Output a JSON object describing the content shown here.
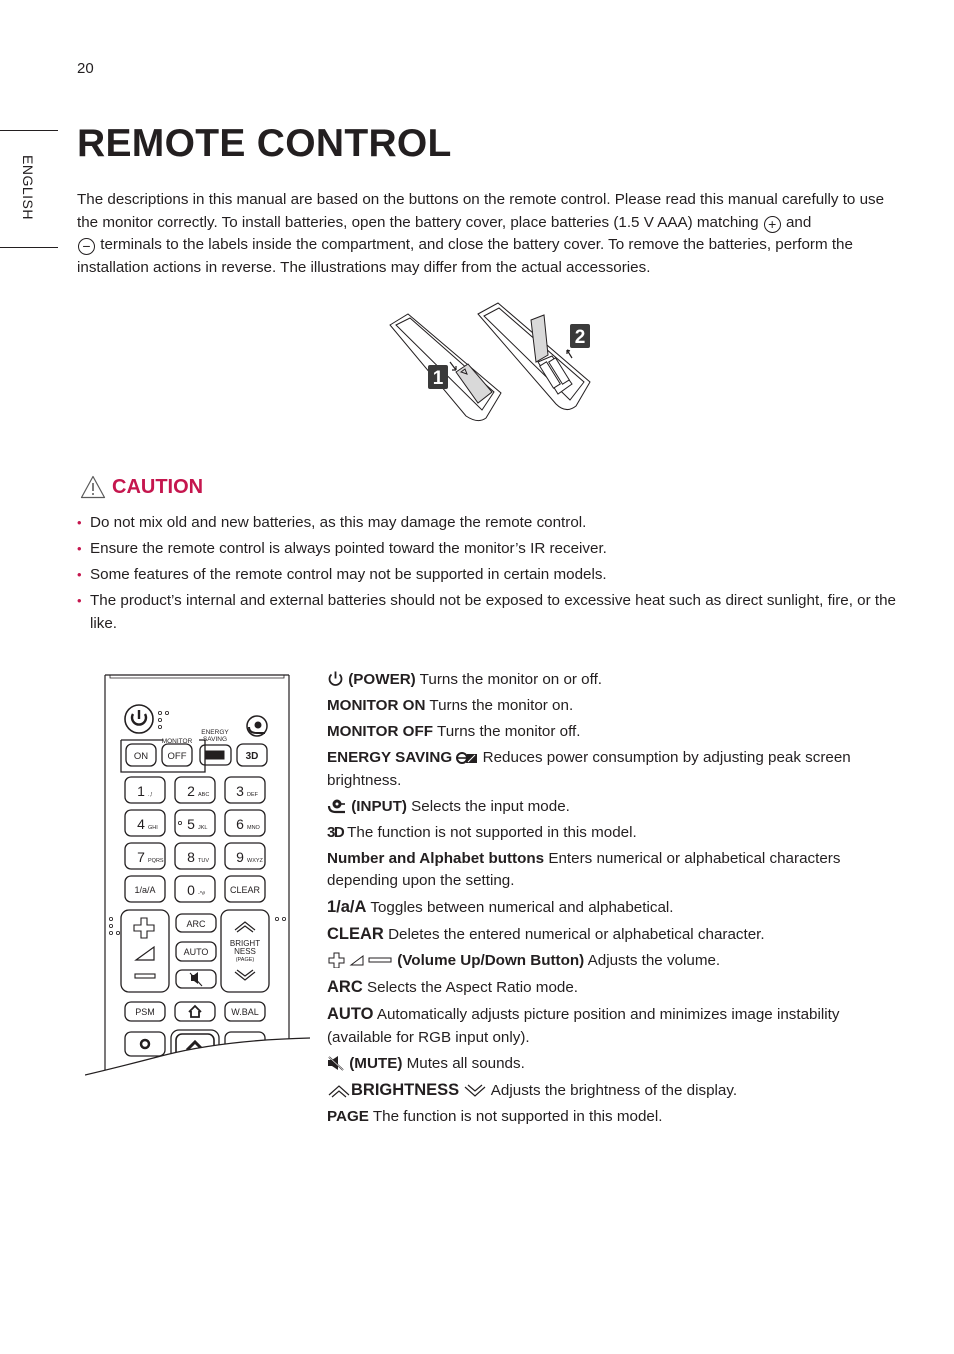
{
  "page": {
    "number": "20",
    "language_tab": "ENGLISH",
    "title": "REMOTE CONTROL"
  },
  "intro": {
    "part1": "The descriptions in this manual are based on the buttons on the remote control. Please read this manual carefully to use the monitor correctly. To install batteries, open the battery cover, place batteries (1.5 V AAA) matching ",
    "plus_symbol": "+",
    "part2": " and ",
    "minus_symbol": "−",
    "part3": " terminals to the labels inside the compartment, and close the battery cover. To remove the batteries, perform the installation actions in reverse. The illustrations may differ from the actual accessories."
  },
  "illustration": {
    "step1": "1",
    "step2": "2"
  },
  "caution": {
    "title": "CAUTION",
    "items": [
      "Do not mix old and new batteries, as this may damage the remote control.",
      "Ensure the remote control is always pointed toward the monitor’s IR receiver.",
      "Some features of the remote control may not be supported in certain models.",
      "The product’s internal and external batteries should not be exposed to excessive heat such as direct sunlight, fire, or the like."
    ]
  },
  "remote": {
    "monitor_label": "MONITOR",
    "energy_label_1": "ENERGY",
    "energy_label_2": "SAVING",
    "on": "ON",
    "off": "OFF",
    "three_d": "3D",
    "keys": [
      {
        "num": "1",
        "sub": ".,!"
      },
      {
        "num": "2",
        "sub": "ABC"
      },
      {
        "num": "3",
        "sub": "DEF"
      },
      {
        "num": "4",
        "sub": "GHI"
      },
      {
        "num": "5",
        "sub": "JKL"
      },
      {
        "num": "6",
        "sub": "MNO"
      },
      {
        "num": "7",
        "sub": "PQRS"
      },
      {
        "num": "8",
        "sub": "TUV"
      },
      {
        "num": "9",
        "sub": "WXYZ"
      }
    ],
    "toggle": "1/a/A",
    "zero": "0",
    "zero_sub": "-*#",
    "clear": "CLEAR",
    "arc": "ARC",
    "auto": "AUTO",
    "bright_1": "BRIGHT",
    "bright_2": "NESS",
    "page": "(PAGE)",
    "psm": "PSM",
    "wbal": "W.BAL"
  },
  "descriptions": [
    {
      "label": "(POWER)",
      "text": " Turns the monitor on or off."
    },
    {
      "label": "MONITOR ON",
      "text": " Turns the monitor on."
    },
    {
      "label": "MONITOR OFF",
      "text": " Turns the monitor off."
    },
    {
      "label": "ENERGY SAVING",
      "text": " Reduces power consumption by adjusting peak screen brightness."
    },
    {
      "label": "(INPUT)",
      "text": " Selects the input mode."
    },
    {
      "label": "",
      "text": " The function is not supported in this model."
    },
    {
      "label": "Number and Alphabet buttons",
      "text": " Enters numerical or alphabetical characters depending upon the setting."
    },
    {
      "label": "1/a/A",
      "text": " Toggles between numerical and alphabetical."
    },
    {
      "label": "CLEAR",
      "text": " Deletes the entered numerical or alphabetical character."
    },
    {
      "label": "(Volume Up/Down Button)",
      "text": " Adjusts the volume."
    },
    {
      "label": "ARC",
      "text": " Selects the Aspect Ratio mode."
    },
    {
      "label": "AUTO",
      "text": " Automatically adjusts picture position and minimizes image instability (available for RGB input only)."
    },
    {
      "label": "(MUTE)",
      "text": " Mutes all sounds."
    },
    {
      "label": "BRIGHTNESS",
      "text": " Adjusts the brightness of the display."
    },
    {
      "label": "PAGE",
      "text": " The function is not supported in this model."
    }
  ],
  "colors": {
    "accent": "#c5164e",
    "text": "#231f20",
    "illustration_fill": "#d9d9d9",
    "step_badge": "#3a3a3a"
  }
}
